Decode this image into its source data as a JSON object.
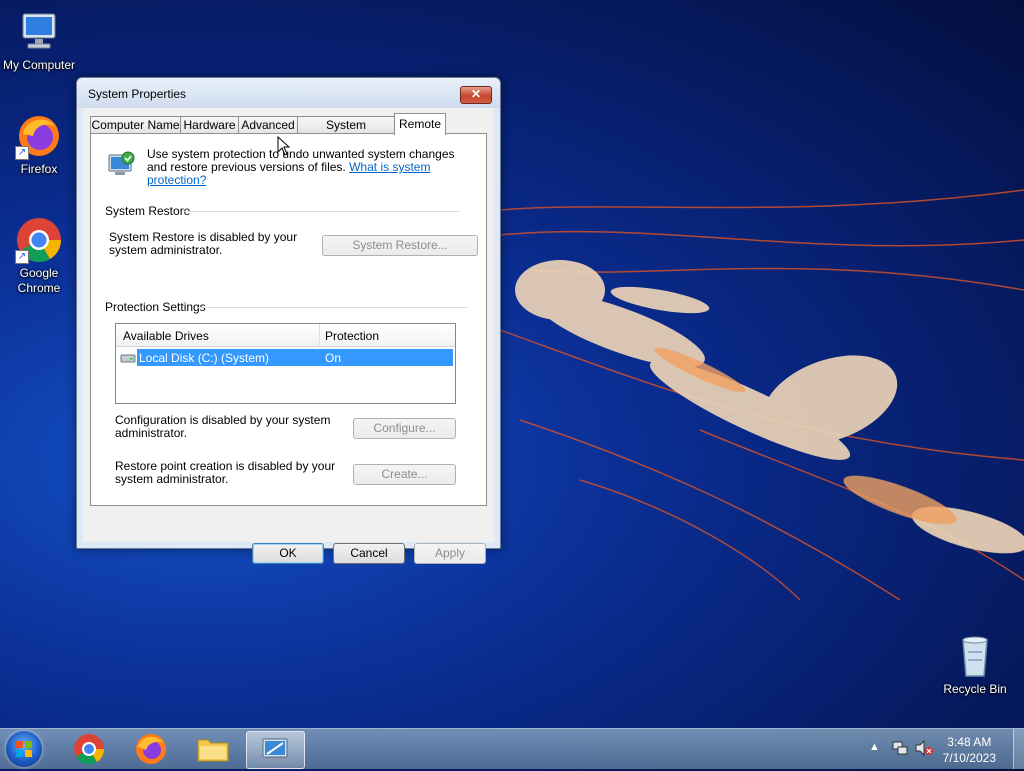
{
  "desktop": {
    "icons": [
      {
        "label": "My Computer"
      },
      {
        "label": "Firefox"
      },
      {
        "label": "Google Chrome"
      },
      {
        "label": "Recycle Bin"
      }
    ]
  },
  "window": {
    "title": "System Properties",
    "close_label": "✕",
    "tabs": [
      {
        "label": "Computer Name"
      },
      {
        "label": "Hardware"
      },
      {
        "label": "Advanced"
      },
      {
        "label": "System Protection"
      },
      {
        "label": "Remote"
      }
    ],
    "intro_text": "Use system protection to undo unwanted system changes and restore previous versions of files.",
    "intro_link": "What is system protection?",
    "system_restore": {
      "heading": "System Restore",
      "text": "System Restore is disabled by your system administrator.",
      "button": "System Restore..."
    },
    "protection_settings": {
      "heading": "Protection Settings",
      "columns": [
        "Available Drives",
        "Protection"
      ],
      "rows": [
        {
          "drive": "Local Disk (C:) (System)",
          "protection": "On"
        }
      ]
    },
    "configure": {
      "text": "Configuration is disabled by your system administrator.",
      "button": "Configure..."
    },
    "create": {
      "text": "Restore point creation is disabled by your system administrator.",
      "button": "Create..."
    },
    "buttons": {
      "ok": "OK",
      "cancel": "Cancel",
      "apply": "Apply"
    }
  },
  "taskbar": {
    "time": "3:48 AM",
    "date": "7/10/2023",
    "items": [
      "start-orb",
      "chrome-icon",
      "firefox-icon",
      "file-explorer-icon",
      "system-properties-icon"
    ]
  },
  "colors": {
    "selection": "#3399ff",
    "link": "#0066cc"
  }
}
